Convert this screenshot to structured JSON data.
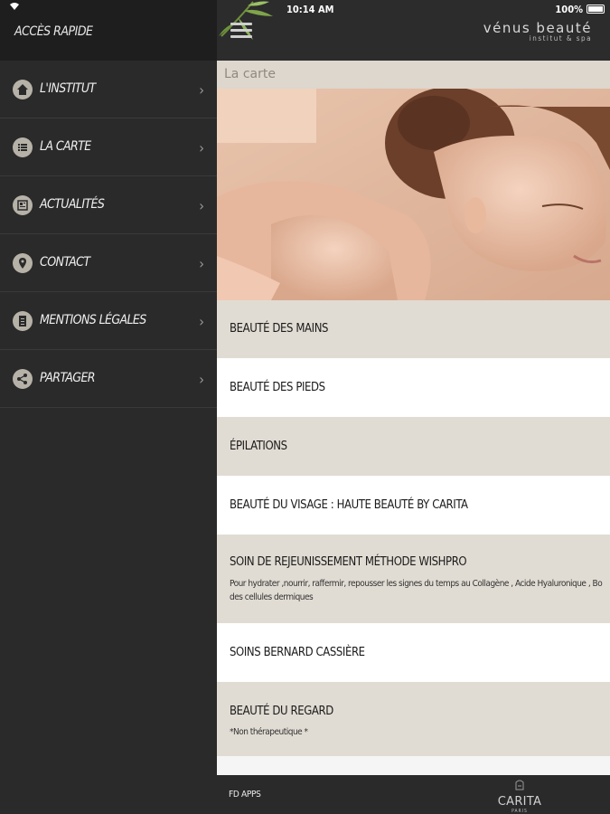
{
  "status_bar": {
    "time": "10:14 AM",
    "battery": "100%"
  },
  "drawer": {
    "title": "ACCÈS RAPIDE",
    "items": [
      {
        "label": "L'INSTITUT",
        "icon": "home-icon"
      },
      {
        "label": "LA CARTE",
        "icon": "list-icon"
      },
      {
        "label": "ACTUALITÉS",
        "icon": "news-icon"
      },
      {
        "label": "CONTACT",
        "icon": "location-pin-icon"
      },
      {
        "label": "MENTIONS LÉGALES",
        "icon": "document-icon"
      },
      {
        "label": "PARTAGER",
        "icon": "share-icon"
      }
    ]
  },
  "header": {
    "brand_name": "vénus beauté",
    "brand_sub": "institut & spa"
  },
  "breadcrumb": "La carte",
  "menu": [
    {
      "title": "BEAUTÉ DES MAINS"
    },
    {
      "title": "BEAUTÉ DES PIEDS"
    },
    {
      "title": "ÉPILATIONS"
    },
    {
      "title": "BEAUTÉ DU VISAGE : HAUTE BEAUTÉ BY CARITA"
    },
    {
      "title": "SOIN DE REJEUNISSEMENT MÉTHODE WISHPRO",
      "desc_line1": "Pour hydrater ,nourrir, raffermir, repousser les signes du temps au Collagène , Acide Hyaluronique , Bo",
      "desc_line2": "des cellules dermiques"
    },
    {
      "title": "SOINS BERNARD CASSIÈRE"
    },
    {
      "title": "BEAUTÉ DU REGARD",
      "desc_line1": "*Non thérapeutique *"
    }
  ],
  "footer": {
    "fd_apps": "FD APPS",
    "carita_name": "CARITA",
    "carita_city": "PARIS"
  },
  "colors": {
    "drawer_bg": "#2a2a2a",
    "beige": "#e1dcd3",
    "breadcrumb_bg": "#ddd7cd"
  }
}
